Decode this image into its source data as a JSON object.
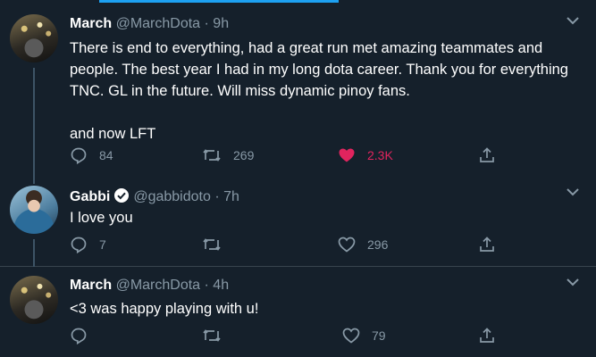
{
  "tweets": [
    {
      "name": "March",
      "handle": "@MarchDota",
      "time": "9h",
      "verified": false,
      "text_lines": [
        "There is end to everything, had a great run met amazing teammates and",
        "people. The best year I had in my long dota career. Thank you for everything",
        "TNC. GL in the future. Will miss dynamic pinoy fans.",
        "",
        "and now LFT"
      ],
      "replies": "84",
      "retweets": "269",
      "likes": "2.3K",
      "liked": true
    },
    {
      "name": "Gabbi",
      "handle": "@gabbidoto",
      "time": "7h",
      "verified": true,
      "text_lines": [
        "I love you"
      ],
      "replies": "7",
      "retweets": "",
      "likes": "296",
      "liked": false
    },
    {
      "name": "March",
      "handle": "@MarchDota",
      "time": "4h",
      "verified": false,
      "text_lines": [
        "<3 was happy playing with u!"
      ],
      "replies": "",
      "retweets": "",
      "likes": "79",
      "liked": false
    }
  ],
  "separator": " · ",
  "icons": {
    "reply": "reply-icon",
    "retweet": "retweet-icon",
    "like": "heart-icon",
    "share": "share-icon",
    "more": "chevron-down-icon",
    "verified": "verified-badge-icon"
  },
  "colors": {
    "background": "#15202b",
    "muted": "#8899a6",
    "accent": "#1da1f2",
    "like": "#e0245e",
    "thread_line": "#3d5466"
  }
}
